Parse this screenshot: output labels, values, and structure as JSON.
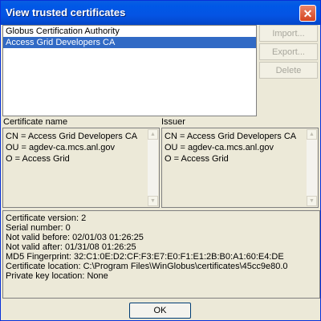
{
  "window": {
    "title": "View trusted certificates"
  },
  "certificates": [
    {
      "label": "Globus Certification Authority",
      "selected": false
    },
    {
      "label": "Access Grid Developers CA",
      "selected": true
    }
  ],
  "buttons": {
    "import": "Import...",
    "export": "Export...",
    "delete": "Delete",
    "ok": "OK"
  },
  "certificate_name": {
    "label": "Certificate name",
    "lines": [
      "CN = Access Grid Developers CA",
      "OU = agdev-ca.mcs.anl.gov",
      "O = Access Grid"
    ]
  },
  "issuer": {
    "label": "Issuer",
    "lines": [
      "CN = Access Grid Developers CA",
      "OU = agdev-ca.mcs.anl.gov",
      "O = Access Grid"
    ]
  },
  "details": {
    "lines": [
      "Certificate version: 2",
      "Serial number: 0",
      "Not valid before: 02/01/03 01:26:25",
      "Not valid after: 01/31/08 01:26:25",
      "MD5 Fingerprint: 32:C1:0E:D2:CF:F3:E7:E0:F1:E1:2B:B0:A1:60:E4:DE",
      "Certificate location: C:\\Program Files\\WinGlobus\\certificates\\45cc9e80.0",
      "Private key location: None"
    ]
  },
  "colors": {
    "titlebar": "#0058e6",
    "selection": "#316ac5",
    "dialog_bg": "#ece9d8"
  }
}
